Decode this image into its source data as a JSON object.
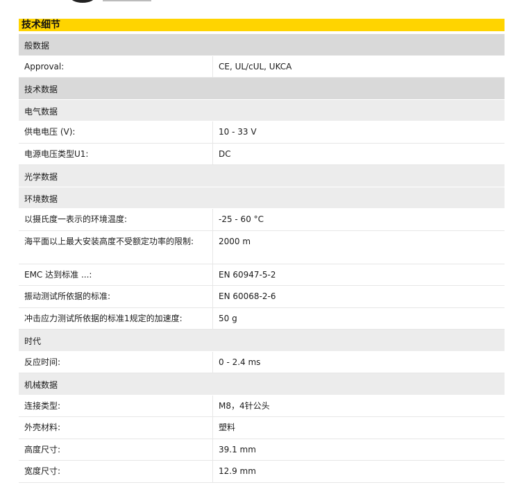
{
  "title": "技术细节",
  "rows": [
    {
      "kind": "sec1",
      "label": "般数据"
    },
    {
      "kind": "data",
      "label": "Approval:",
      "value": "CE, UL/cUL, UKCA"
    },
    {
      "kind": "sec1",
      "label": "技术数据"
    },
    {
      "kind": "sec2",
      "label": "电气数据"
    },
    {
      "kind": "data",
      "label": "供电电压 (V):",
      "value": "10 - 33 V"
    },
    {
      "kind": "data",
      "label": "电源电压类型U1:",
      "value": "DC"
    },
    {
      "kind": "sec2",
      "label": "光学数据"
    },
    {
      "kind": "sec2",
      "label": "环境数据"
    },
    {
      "kind": "data",
      "label": "以摄氏度一表示的环境温度:",
      "value": "-25 - 60 °C"
    },
    {
      "kind": "data",
      "tall": true,
      "label": "海平面以上最大安装高度不受额定功率的限制:",
      "value": "2000 m"
    },
    {
      "kind": "data",
      "label": "EMC 达到标准 ...:",
      "value": "EN 60947-5-2"
    },
    {
      "kind": "data",
      "label": "振动测试所依据的标准:",
      "value": "EN 60068-2-6"
    },
    {
      "kind": "data",
      "label": "冲击应力测试所依据的标准1规定的加速度:",
      "value": "50 g"
    },
    {
      "kind": "sec2",
      "label": "时代"
    },
    {
      "kind": "data",
      "label": "反应时间:",
      "value": "0 - 2.4 ms"
    },
    {
      "kind": "sec2",
      "label": "机械数据"
    },
    {
      "kind": "data",
      "label": "连接类型:",
      "value": "M8，4针公头"
    },
    {
      "kind": "data",
      "label": "外壳材料:",
      "value": "塑料"
    },
    {
      "kind": "data",
      "label": "高度尺寸:",
      "value": "39.1 mm"
    },
    {
      "kind": "data",
      "label": "宽度尺寸:",
      "value": "12.9 mm"
    }
  ]
}
